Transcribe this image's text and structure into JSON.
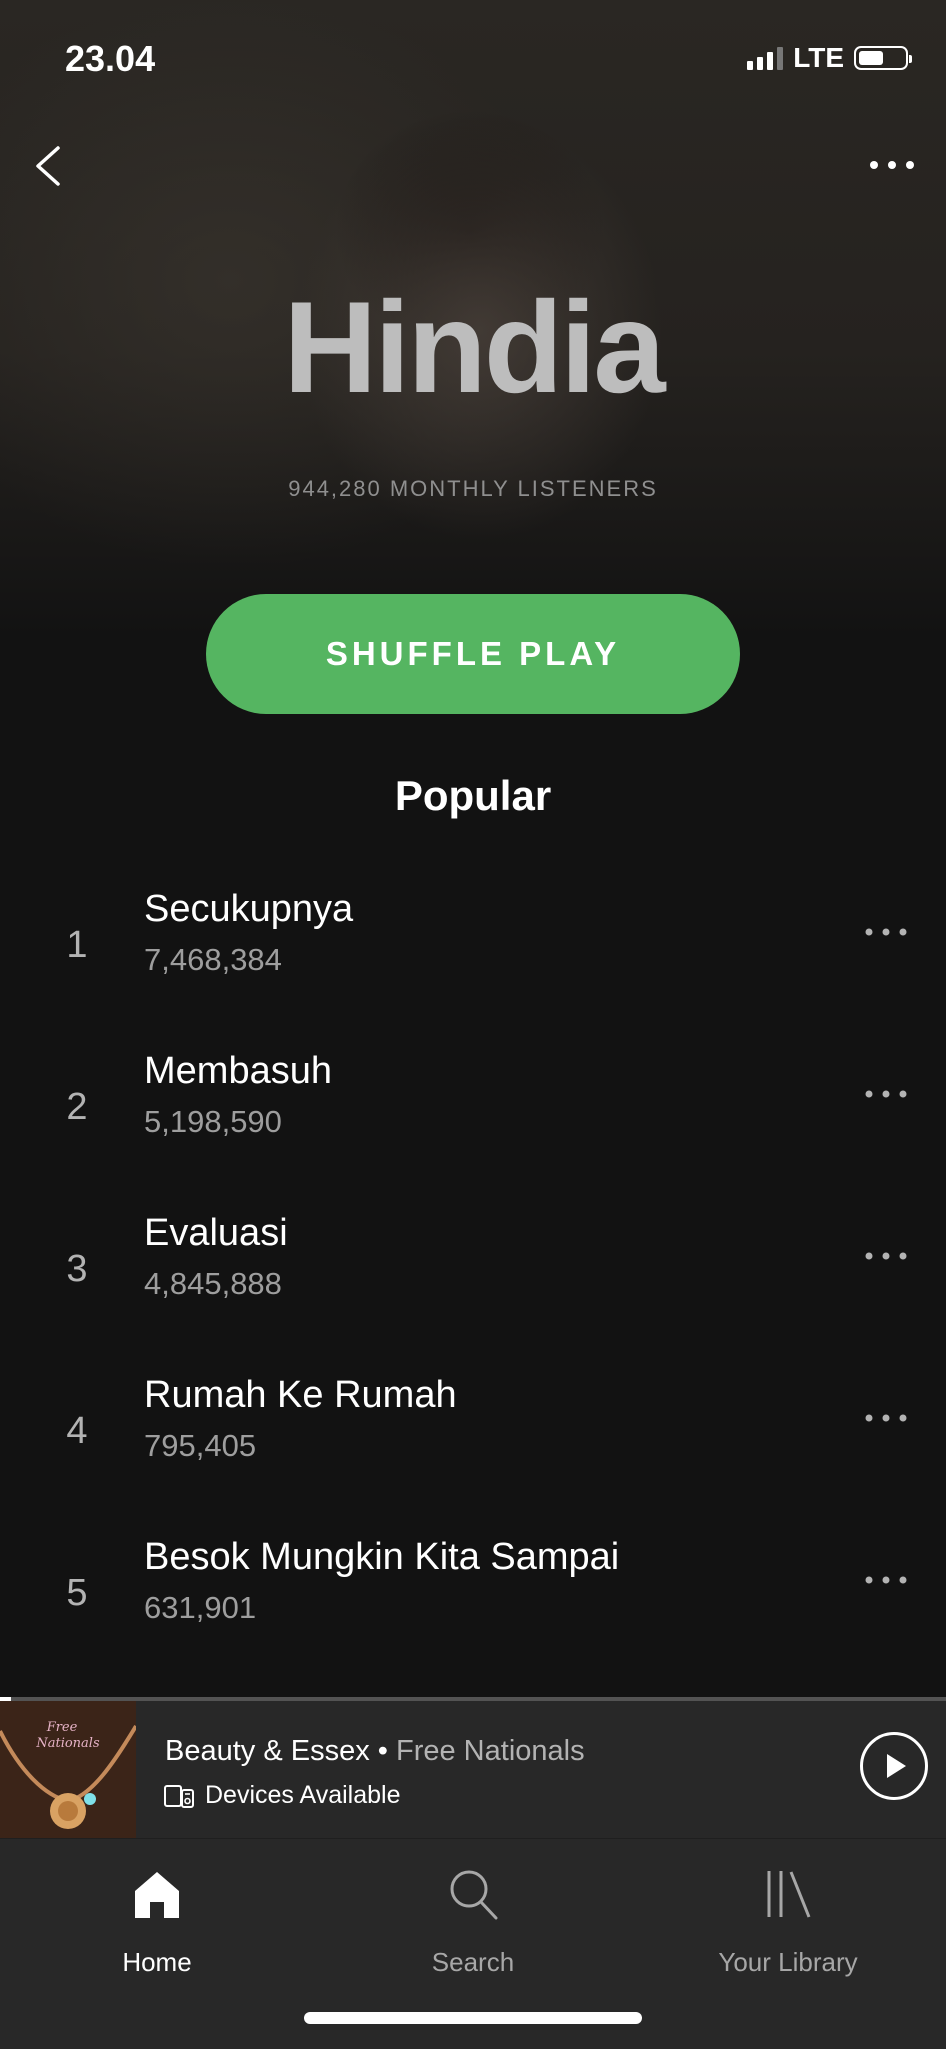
{
  "status_bar": {
    "time": "23.04",
    "network": "LTE"
  },
  "artist": {
    "name": "Hindia",
    "monthly_listeners": "944,280 MONTHLY LISTENERS"
  },
  "shuffle_label": "SHUFFLE PLAY",
  "popular": {
    "title": "Popular",
    "tracks": [
      {
        "rank": "1",
        "title": "Secukupnya",
        "plays": "7,468,384"
      },
      {
        "rank": "2",
        "title": "Membasuh",
        "plays": "5,198,590"
      },
      {
        "rank": "3",
        "title": "Evaluasi",
        "plays": "4,845,888"
      },
      {
        "rank": "4",
        "title": "Rumah Ke Rumah",
        "plays": "795,405"
      },
      {
        "rank": "5",
        "title": "Besok Mungkin Kita Sampai",
        "plays": "631,901"
      }
    ]
  },
  "now_playing": {
    "title": "Beauty & Essex",
    "separator": "•",
    "artist": "Free Nationals",
    "devices_label": "Devices Available",
    "progress": 0.012,
    "album_art_text": "Free Nationals"
  },
  "tabs": [
    {
      "label": "Home",
      "icon": "home-icon",
      "active": true
    },
    {
      "label": "Search",
      "icon": "search-icon",
      "active": false
    },
    {
      "label": "Your Library",
      "icon": "library-icon",
      "active": false
    }
  ],
  "colors": {
    "accent": "#55b561",
    "background": "#121212",
    "player": "#282828"
  }
}
